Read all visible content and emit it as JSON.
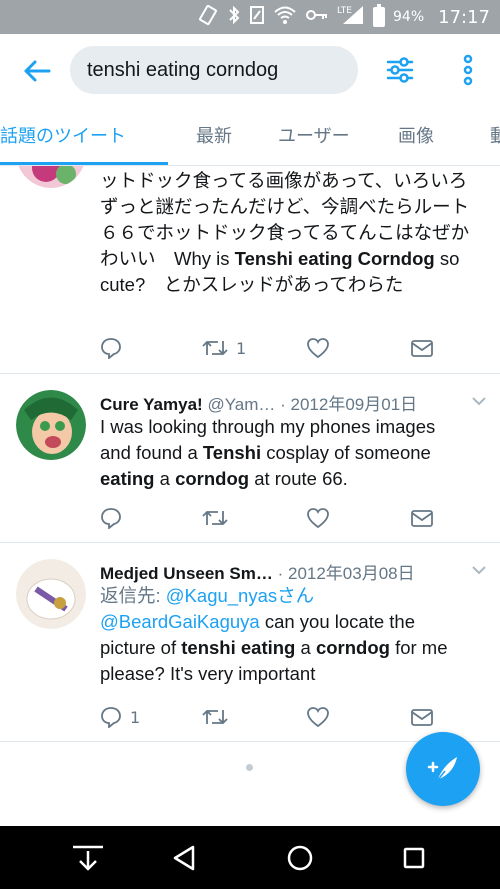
{
  "status": {
    "battery_pct": "94%",
    "time": "17:17",
    "network": "LTE"
  },
  "search": {
    "query": "tenshi eating corndog"
  },
  "tabs": [
    {
      "label": "話題のツイート",
      "active": true
    },
    {
      "label": "最新",
      "active": false
    },
    {
      "label": "ユーザー",
      "active": false
    },
    {
      "label": "画像",
      "active": false
    },
    {
      "label": "動",
      "active": false
    }
  ],
  "tweets": [
    {
      "text_parts": [
        {
          "t": "ットドック食ってる画像があって、いろいろずっと謎だったんだけど、今調べたらルート６６でホットドック食ってるてんこはなぜかわいい　Why is ",
          "b": false
        },
        {
          "t": "Tenshi eating Corndog",
          "b": true
        },
        {
          "t": " so cute?　とかスレッドがあってわらた",
          "b": false
        }
      ],
      "reply_count": "",
      "retweet_count": "1",
      "like_count": ""
    },
    {
      "name": "Cure Yamya!",
      "handle": "@Yam…",
      "date": "· 2012年09月01日",
      "text_parts": [
        {
          "t": "I was looking through my phones images and found a ",
          "b": false
        },
        {
          "t": "Tenshi",
          "b": true
        },
        {
          "t": " cosplay of someone ",
          "b": false
        },
        {
          "t": "eating",
          "b": true
        },
        {
          "t": " a ",
          "b": false
        },
        {
          "t": "corndog",
          "b": true
        },
        {
          "t": " at route 66.",
          "b": false
        }
      ],
      "reply_count": "",
      "retweet_count": "",
      "like_count": ""
    },
    {
      "name": "Medjed Unseen Sm…",
      "date": "· 2012年03月08日",
      "reply_to_label": "返信先: ",
      "reply_to_user": "@Kagu_nyas",
      "reply_to_suffix": "さん",
      "text_parts": [
        {
          "t": "@BeardGaiKaguya",
          "link": true
        },
        {
          "t": " can you locate the picture of ",
          "b": false
        },
        {
          "t": "tenshi eating",
          "b": true
        },
        {
          "t": " a ",
          "b": false
        },
        {
          "t": "corndog",
          "b": true
        },
        {
          "t": " for me please? It's very important",
          "b": false
        }
      ],
      "reply_count": "1",
      "retweet_count": "",
      "like_count": ""
    }
  ],
  "colors": {
    "accent": "#1da1f2",
    "text": "#14171a",
    "muted": "#657786",
    "status_bar": "#9ea4a8"
  },
  "icons": [
    "back-arrow-icon",
    "filter-icon",
    "more-vertical-icon",
    "reply-icon",
    "retweet-icon",
    "like-icon",
    "dm-icon",
    "compose-icon",
    "chevron-down-icon"
  ]
}
